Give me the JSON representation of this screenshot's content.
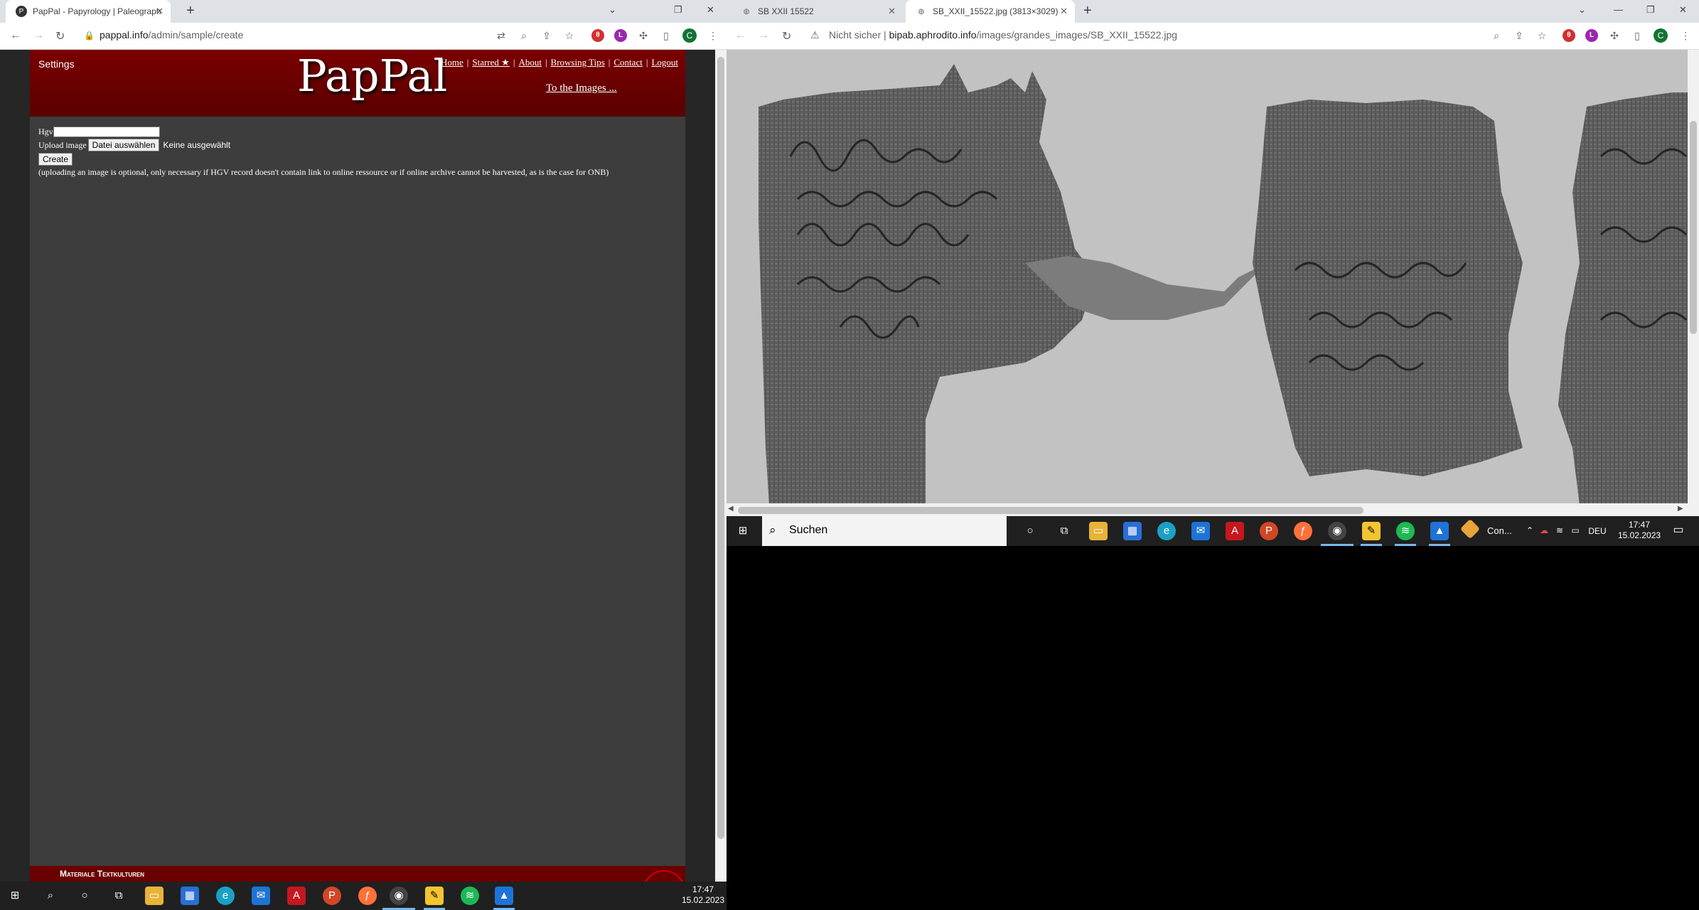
{
  "left_browser": {
    "tabs": [
      {
        "title": "PapPal - Papyrology | Paleograph"
      }
    ],
    "url": {
      "host": "pappal.info",
      "path": "/admin/sample/create"
    }
  },
  "right_browser": {
    "tabs": [
      {
        "title": "SB XXII 15522"
      },
      {
        "title": "SB_XXII_15522.jpg (3813×3029)"
      }
    ],
    "url": {
      "security": "Nicht sicher",
      "host": "bipab.aphrodito.info",
      "path": "/images/grandes_images/SB_XXII_15522.jpg"
    }
  },
  "site": {
    "settings": "Settings",
    "logo": "PapPal",
    "nav": [
      "Home",
      "Starred ★",
      "About",
      "Browsing Tips",
      "Contact",
      "Logout"
    ],
    "to_images": "To the Images ...",
    "footer": "Materiale Textkulturen"
  },
  "form": {
    "hgv_label": "Hgv",
    "hgv_value": "",
    "upload_label": "Upload image",
    "file_button": "Datei auswählen",
    "file_status": "Keine ausgewählt",
    "create_button": "Create",
    "note": "(uploading an image is optional, only necessary if HGV record doesn't contain link to online ressource or if online archive cannot be harvested, as is the case for ONB)"
  },
  "taskbar_left": {
    "time": "17:47",
    "date": "15.02.2023"
  },
  "taskbar_right": {
    "search": "Suchen",
    "task_label": "Con...",
    "lang": "DEU",
    "time": "17:47",
    "date": "15.02.2023"
  },
  "colors": {
    "header": "#6e0000",
    "page_bg": "#3d3d3d",
    "taskbar": "#202020"
  }
}
